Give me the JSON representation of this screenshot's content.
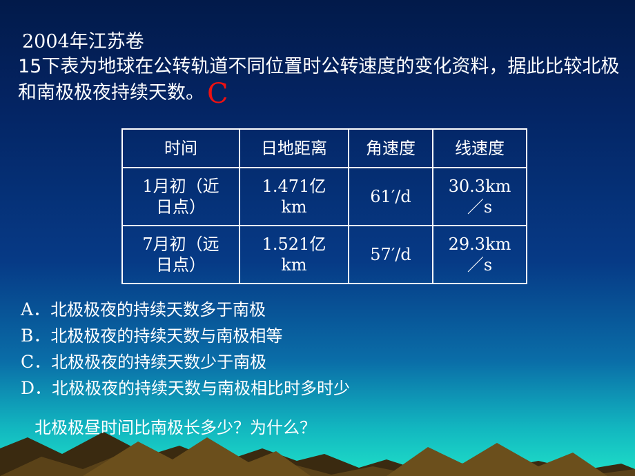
{
  "slide": {
    "source_label": "2004年江苏卷",
    "question": "15下表为地球在公转轨道不同位置时公转速度的变化资料，据此比较北极和南极极夜持续天数。",
    "answer_mark": "C",
    "table": {
      "headers": [
        "时间",
        "日地距离",
        "角速度",
        "线速度"
      ],
      "rows": [
        [
          "1月初（近日点）",
          "1.471亿km",
          "61′/d",
          "30.3km/s"
        ],
        [
          "7月初（远日点）",
          "1.521亿km",
          "57′/d",
          "29.3km/s"
        ]
      ],
      "cells": {
        "r1c1_line1": "1月初（近",
        "r1c1_line2": "日点）",
        "r1c2_line1": "1.471亿",
        "r1c2_line2": "km",
        "r1c3": "61′/d",
        "r1c4_line1": "30.3km",
        "r1c4_line2": "／s",
        "r2c1_line1": "7月初（远",
        "r2c1_line2": "日点）",
        "r2c2_line1": "1.521亿",
        "r2c2_line2": "km",
        "r2c3": "57′/d",
        "r2c4_line1": "29.3km",
        "r2c4_line2": "／s"
      }
    },
    "options": [
      {
        "label": "A．",
        "text": "北极极夜的持续天数多于南极"
      },
      {
        "label": "B．",
        "text": "北极极夜的持续天数与南极相等"
      },
      {
        "label": "C．",
        "text": "北极极夜的持续天数少于南极"
      },
      {
        "label": "D．",
        "text": "北极极夜的持续天数与南极相比时多时少"
      }
    ],
    "footer_question": "北极极昼时间比南极长多少？为什么？"
  }
}
